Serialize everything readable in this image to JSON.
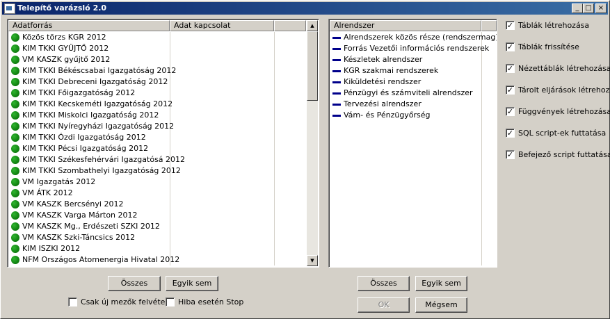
{
  "window": {
    "title": "Telepítő varázsló 2.0",
    "controls": {
      "minimize": "_",
      "maximize": "□",
      "close": "×"
    }
  },
  "left_list": {
    "columns": [
      "Adatforrás",
      "Adat kapcsolat"
    ],
    "rows": [
      " Közös törzs KGR 2012",
      "KIM TKKI  GYŰJTŐ 2012",
      "VM KASZK  gyűjtő 2012",
      "KIM TKKI Békéscsabai Igazgatóság 2012",
      "KIM TKKI Debreceni Igazgatóság 2012",
      "KIM TKKI Főigazgatóság 2012",
      "KIM TKKI Kecskeméti Igazgatóság 2012",
      "KIM TKKI Miskolci Igazgatóság 2012",
      "KIM TKKI Nyíregyházi Igazgatóság 2012",
      "KIM TKKI Ózdi Igazgatóság 2012",
      "KIM TKKI Pécsi Igazgatóság 2012",
      "KIM TKKI Székesfehérvári Igazgatósá 2012",
      "KIM TKKI Szombathelyi Igazgatóság 2012",
      "VM Igazgatás 2012",
      "VM ÁTK 2012",
      "VM KASZK Bercsényi 2012",
      "VM KASZK Varga Márton 2012",
      "VM KASZK Mg., Erdészeti SZKI 2012",
      "VM KASZK Szki-Táncsics 2012",
      "KIM ISZKI 2012",
      "NFM Országos Atomenergia Hivatal 2012"
    ],
    "buttons": {
      "all": "Összes",
      "none": "Egyik sem"
    },
    "options": [
      {
        "label": "Csak új mezők felvétele",
        "checked": false
      },
      {
        "label": "Hiba esetén Stop",
        "checked": false
      }
    ]
  },
  "right_list": {
    "column": "Alrendszer",
    "rows": [
      "Alrendszerek közös része (rendszermag)",
      "Forrás Vezetői információs rendszerek",
      "Készletek alrendszer",
      "KGR szakmai rendszerek",
      "Kiküldetési rendszer",
      "Pénzügyi és számviteli alrendszer",
      "Tervezési alrendszer",
      "Vám- és Pénzügyőrség"
    ],
    "buttons": {
      "all": "Összes",
      "none": "Egyik sem",
      "ok": "OK",
      "cancel": "Mégsem"
    }
  },
  "tasks": [
    {
      "label": "Táblák létrehozása",
      "checked": true
    },
    {
      "label": "Táblák frissítése",
      "checked": true
    },
    {
      "label": "Nézettáblák létrehozása",
      "checked": true
    },
    {
      "label": "Tárolt eljárások létrehozása",
      "checked": true
    },
    {
      "label": "Függvények létrehozása",
      "checked": true
    },
    {
      "label": "SQL script-ek futtatása",
      "checked": true
    },
    {
      "label": "Befejező script futtatása",
      "checked": true
    }
  ],
  "colors": {
    "titlebar": "#0a246a",
    "face": "#d4d0c8",
    "status_dot": "#1e8c1e",
    "dash": "#00008b"
  },
  "icons": {
    "row_status": "green-dot-icon",
    "subsystem": "blue-dash-icon",
    "check": "checkmark-icon"
  }
}
